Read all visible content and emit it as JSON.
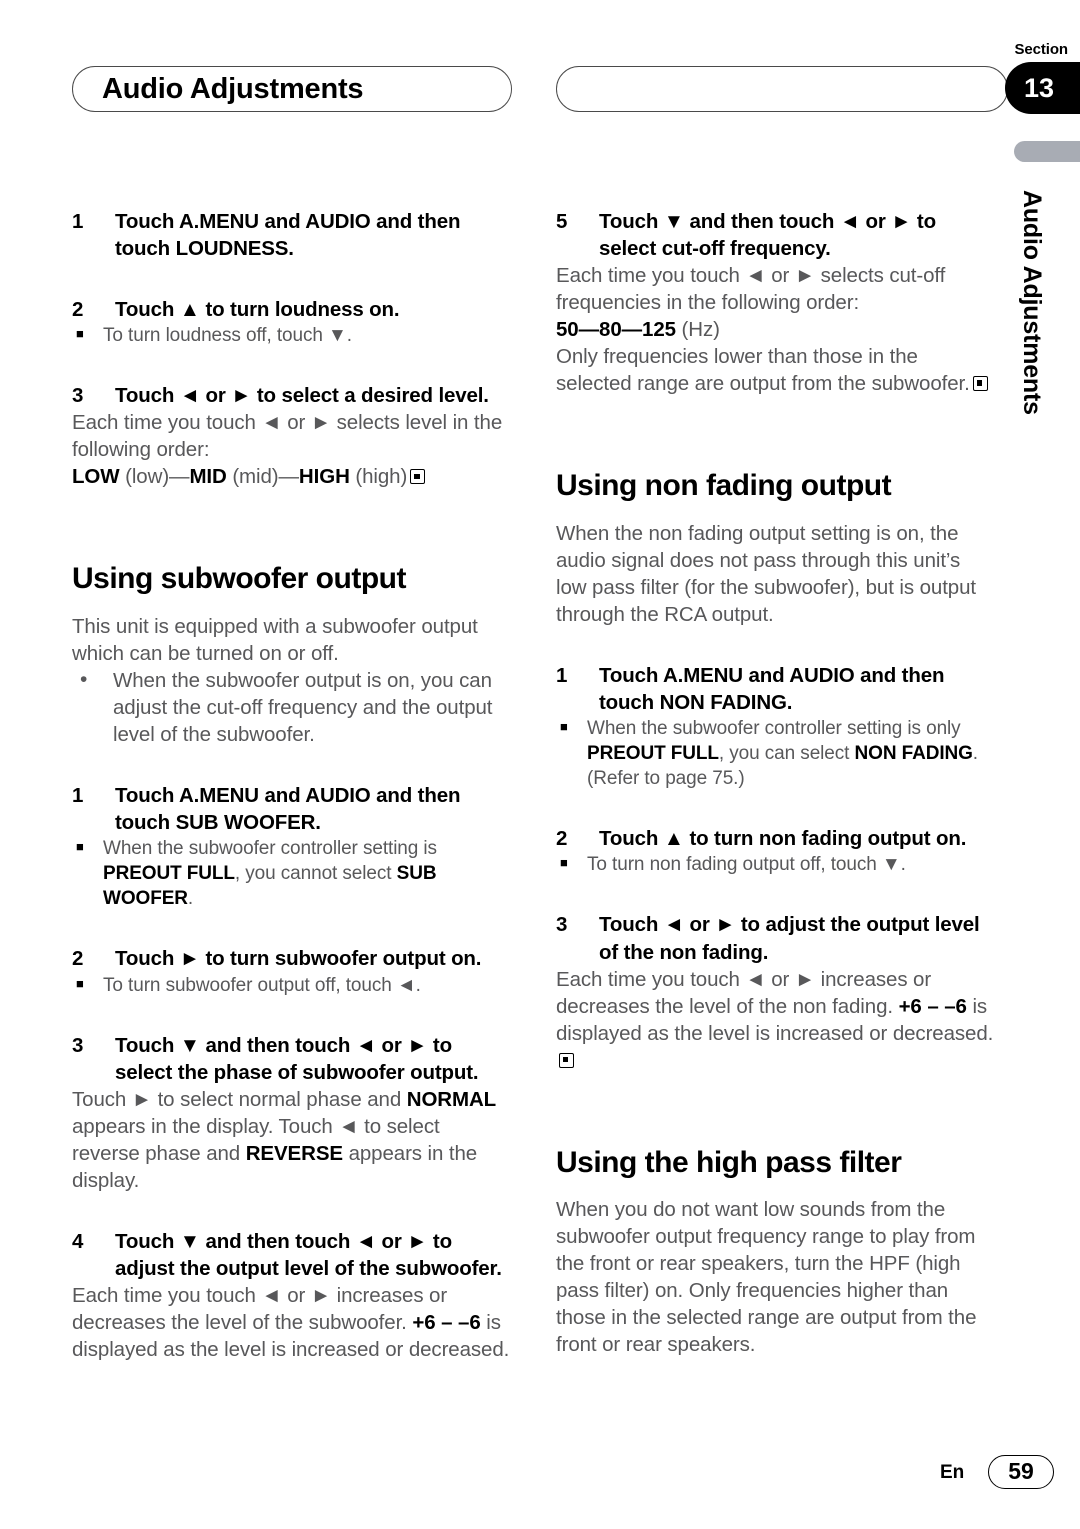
{
  "header": {
    "title": "Audio Adjustments",
    "section_label": "Section",
    "section_number": "13",
    "side_tab_text": "Audio Adjustments"
  },
  "footer": {
    "language": "En",
    "page_number": "59"
  },
  "colors": {
    "body_text": "#58585a",
    "heading_text": "#000000",
    "side_bar_gray": "#a8acb4"
  },
  "left_column": {
    "loudness": {
      "step1": "Touch A.MENU and AUDIO and then touch LOUDNESS.",
      "step1_num": "1",
      "step2": "Touch ▲ to turn loudness on.",
      "step2_num": "2",
      "step2_note": "To turn loudness off, touch ▼.",
      "step3": "Touch ◄ or ► to select a desired level.",
      "step3_num": "3",
      "step3_body": "Each time you touch ◄ or ► selects level in the following order:",
      "step3_order_low": "LOW",
      "step3_order_low_paren": " (low)—",
      "step3_order_mid": "MID",
      "step3_order_mid_paren": " (mid)—",
      "step3_order_high": "HIGH",
      "step3_order_high_paren": " (high)"
    },
    "subwoofer": {
      "heading": "Using subwoofer output",
      "intro": "This unit is equipped with a subwoofer output which can be turned on or off.",
      "bullet1": "When the subwoofer output is on, you can adjust the cut-off frequency and the output level of the subwoofer.",
      "step1": "Touch A.MENU and AUDIO and then touch SUB WOOFER.",
      "step1_num": "1",
      "step1_note_a": "When the subwoofer controller setting is ",
      "step1_note_b": "PREOUT FULL",
      "step1_note_c": ", you cannot select ",
      "step1_note_d": "SUB WOOFER",
      "step1_note_e": ".",
      "step2": "Touch ► to turn subwoofer output on.",
      "step2_num": "2",
      "step2_note": "To turn subwoofer output off, touch ◄.",
      "step3": "Touch ▼ and then touch ◄ or ► to select the phase of subwoofer output.",
      "step3_num": "3",
      "step3_body_a": "Touch ► to select normal phase and ",
      "step3_body_b": "NORMAL",
      "step3_body_c": " appears in the display. Touch ◄ to select reverse phase and ",
      "step3_body_d": "REVERSE",
      "step3_body_e": " appears in the display.",
      "step4": "Touch ▼ and then touch ◄ or ► to adjust the output level of the subwoofer.",
      "step4_num": "4",
      "step4_body_a": "Each time you touch ◄ or ► increases or decreases the level of the subwoofer. ",
      "step4_body_b": "+6 – –6",
      "step4_body_c": " is displayed as the level is increased or decreased."
    }
  },
  "right_column": {
    "subwoofer_cont": {
      "step5": "Touch ▼ and then touch ◄ or ► to select cut-off frequency.",
      "step5_num": "5",
      "step5_body": "Each time you touch ◄ or ► selects cut-off frequencies in the following order:",
      "freq_50": "50",
      "freq_dash1": "—",
      "freq_80": "80",
      "freq_dash2": "—",
      "freq_125": "125",
      "freq_unit": " (Hz)",
      "step5_tail": "Only frequencies lower than those in the selected range are output from the subwoofer."
    },
    "non_fading": {
      "heading": "Using non fading output",
      "intro": "When the non fading output setting is on, the audio signal does not pass through this unit’s low pass filter (for the subwoofer), but is output through the RCA output.",
      "step1": "Touch A.MENU and AUDIO and then touch NON FADING.",
      "step1_num": "1",
      "step1_note_a": "When the subwoofer controller setting is only ",
      "step1_note_b": "PREOUT FULL",
      "step1_note_c": ", you can select ",
      "step1_note_d": "NON FADING",
      "step1_note_e": ". (Refer to page 75.)",
      "step2": "Touch ▲ to turn non fading output on.",
      "step2_num": "2",
      "step2_note": "To turn non fading output off, touch ▼.",
      "step3": "Touch ◄ or ► to adjust the output level of the non fading.",
      "step3_num": "3",
      "step3_body_a": "Each time you touch ◄ or ► increases or decreases the level of the non fading. ",
      "step3_body_b": "+6 – –6",
      "step3_body_c": " is displayed as the level is increased or decreased."
    },
    "high_pass": {
      "heading": "Using the high pass filter",
      "intro": "When you do not want low sounds from the subwoofer output frequency range to play from the front or rear speakers, turn the HPF (high pass filter) on. Only frequencies higher than those in the selected range are output from the front or rear speakers."
    }
  }
}
